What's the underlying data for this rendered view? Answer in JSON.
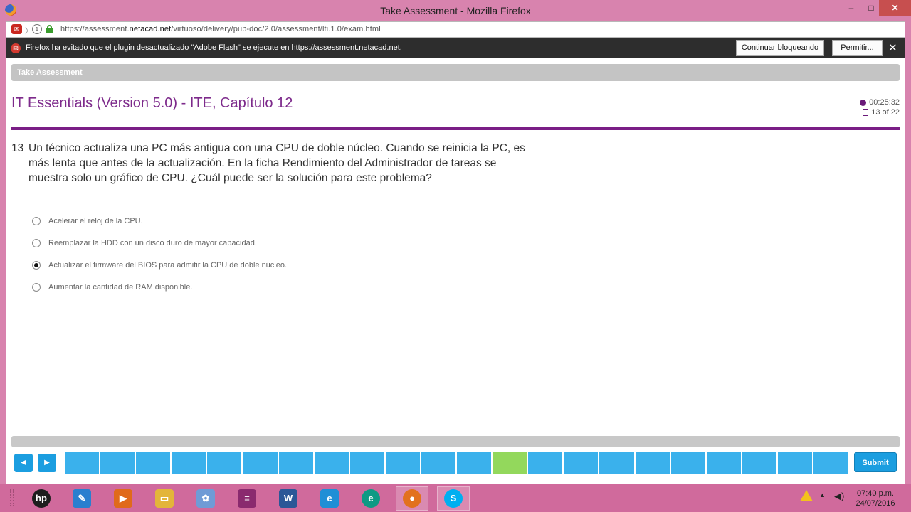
{
  "window": {
    "title": "Take Assessment - Mozilla Firefox",
    "controls": {
      "minimize": "‒",
      "maximize": "□",
      "close": "✕"
    }
  },
  "addressbar": {
    "url_prefix": "https://assessment.",
    "url_domain": "netacad.net",
    "url_path": "/virtuoso/delivery/pub-doc/2.0/assessment/lti.1.0/exam.html"
  },
  "notification": {
    "text": "Firefox ha evitado que el plugin desactualizado \"Adobe Flash\" se ejecute en https://assessment.netacad.net.",
    "continue_blocking_label": "Continuar bloqueando",
    "allow_label": "Permitir...",
    "close_symbol": "✕"
  },
  "assessment": {
    "header_label": "Take Assessment",
    "title": "IT Essentials (Version 5.0) - ITE, Capítulo 12",
    "timer": "00:25:32",
    "progress": "13 of 22",
    "current_question": 13,
    "total_questions": 22
  },
  "question": {
    "number": "13",
    "text": "Un técnico actualiza una PC más antigua con una CPU de doble núcleo. Cuando se reinicia la PC, es más lenta que antes de la actualización. En la ficha Rendimiento del Administrador de tareas se muestra solo un gráfico de CPU. ¿Cuál puede ser la solución para este problema?",
    "options": [
      {
        "label": "Acelerar el reloj de la CPU.",
        "selected": false
      },
      {
        "label": "Reemplazar la HDD con un disco duro de mayor capacidad.",
        "selected": false
      },
      {
        "label": "Actualizar el firmware del BIOS para admitir la CPU de doble núcleo.",
        "selected": true
      },
      {
        "label": "Aumentar la cantidad de RAM disponible.",
        "selected": false
      }
    ]
  },
  "navigation": {
    "prev_symbol": "◀",
    "next_symbol": "▶",
    "submit_label": "Submit"
  },
  "colors": {
    "title_purple": "#7d2a8b",
    "nav_blue": "#3ab1ec",
    "current_green": "#93d85c",
    "taskbar_pink": "#d06a9c"
  },
  "taskbar": {
    "apps": [
      {
        "name": "hp-icon",
        "glyph": "hp",
        "color": "#1e1e1e"
      },
      {
        "name": "feather-app-icon",
        "glyph": "✎",
        "color": "#2a7fcf"
      },
      {
        "name": "media-player-icon",
        "glyph": "▶",
        "color": "#e06a1a"
      },
      {
        "name": "file-explorer-icon",
        "glyph": "▭",
        "color": "#e3b53a"
      },
      {
        "name": "paint-icon",
        "glyph": "✿",
        "color": "#6f9bd6"
      },
      {
        "name": "winrar-icon",
        "glyph": "≡",
        "color": "#8a2a6e"
      },
      {
        "name": "word-icon",
        "glyph": "W",
        "color": "#2b5797"
      },
      {
        "name": "internet-explorer-icon",
        "glyph": "e",
        "color": "#1f8fd6"
      },
      {
        "name": "edge-like-icon",
        "glyph": "e",
        "color": "#0e9a84"
      },
      {
        "name": "firefox-icon",
        "glyph": "●",
        "color": "#e2711d"
      },
      {
        "name": "skype-icon",
        "glyph": "S",
        "color": "#00aff0"
      }
    ],
    "time": "07:40 p.m.",
    "date": "24/07/2016"
  }
}
